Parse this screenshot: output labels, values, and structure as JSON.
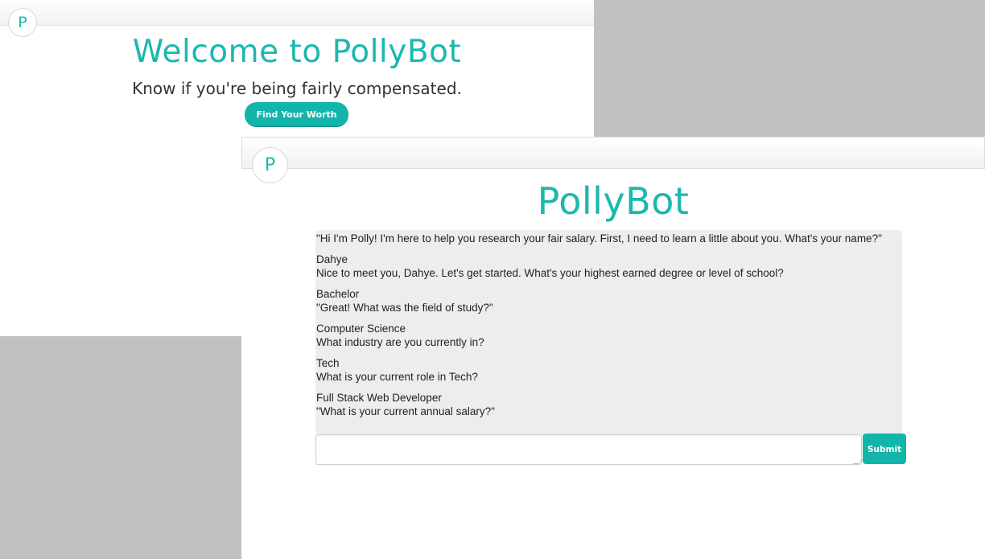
{
  "landing": {
    "logo_letter": "P",
    "title": "Welcome to PollyBot",
    "tagline": "Know if you're being fairly compensated.",
    "cta_label": "Find Your Worth"
  },
  "chat": {
    "logo_letter": "P",
    "title": "PollyBot",
    "messages": [
      {
        "from": "bot",
        "text": "\"Hi I'm Polly! I'm here to help you research your fair salary. First, I need to learn a little about you. What's your name?\""
      },
      {
        "from": "user",
        "text": "Dahye"
      },
      {
        "from": "bot",
        "text": "Nice to meet you, Dahye. Let's get started. What's your highest earned degree or level of school?"
      },
      {
        "from": "user",
        "text": "Bachelor"
      },
      {
        "from": "bot",
        "text": "\"Great! What was the field of study?\""
      },
      {
        "from": "user",
        "text": "Computer Science"
      },
      {
        "from": "bot",
        "text": "What industry are you currently in?"
      },
      {
        "from": "user",
        "text": "Tech"
      },
      {
        "from": "bot",
        "text": "What is your current role in Tech?"
      },
      {
        "from": "user",
        "text": "Full Stack Web Developer"
      },
      {
        "from": "bot",
        "text": "\"What is your current annual salary?\""
      }
    ],
    "input_value": "",
    "input_placeholder": "",
    "submit_label": "Submit"
  },
  "colors": {
    "accent": "#1bb8ae",
    "button": "#12b5aa",
    "chat_background": "#ededed",
    "backdrop": "#c1c1c1"
  }
}
